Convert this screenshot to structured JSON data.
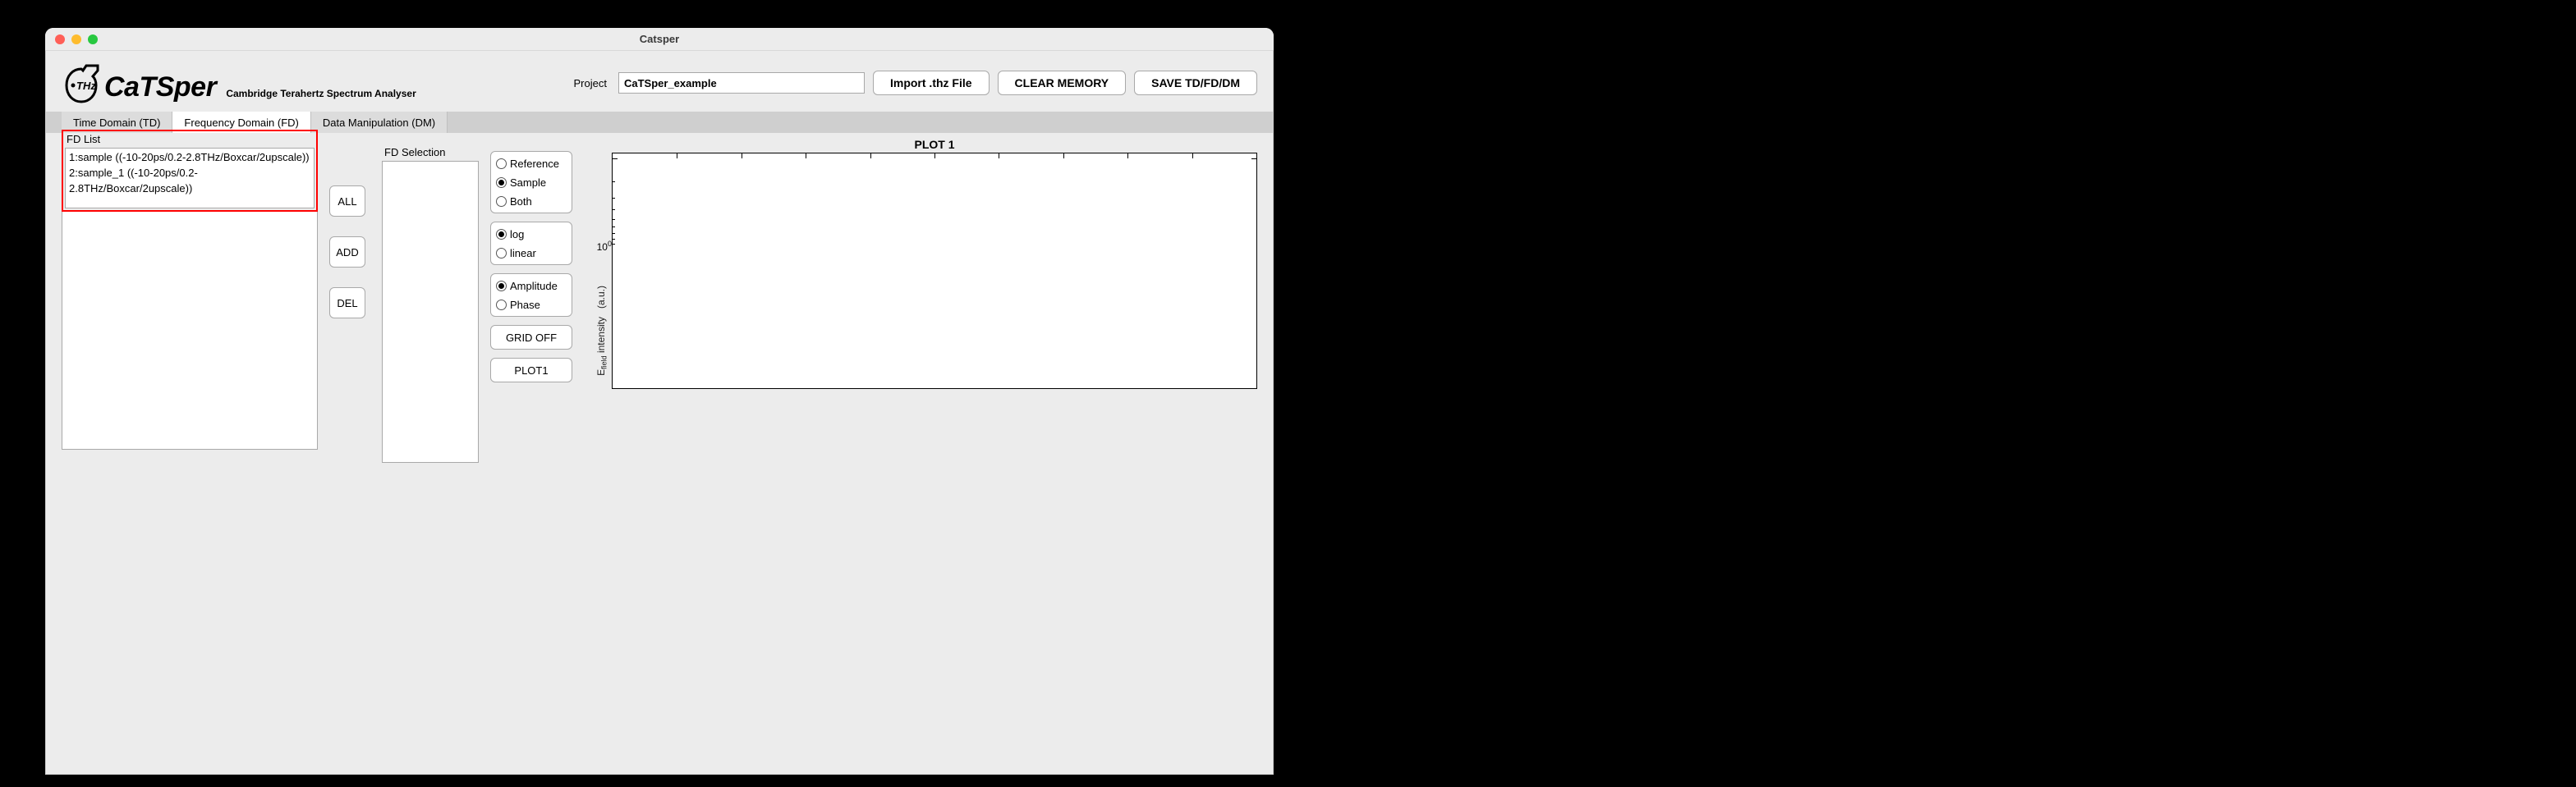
{
  "window_title": "Catsper",
  "app_name": "CaTSper",
  "app_subtitle": "Cambridge Terahertz Spectrum Analyser",
  "project_label": "Project",
  "project_value": "CaTSper_example",
  "header_buttons": {
    "import": "Import .thz File",
    "clear": "CLEAR MEMORY",
    "save": "SAVE TD/FD/DM"
  },
  "tabs": {
    "td": "Time Domain (TD)",
    "fd": "Frequency Domain (FD)",
    "dm": "Data Manipulation (DM)"
  },
  "fd_list_label": "FD List",
  "fd_list_items": [
    "1:sample ((-10-20ps/0.2-2.8THz/Boxcar/2upscale))",
    "2:sample_1 ((-10-20ps/0.2-2.8THz/Boxcar/2upscale))"
  ],
  "btns": {
    "all": "ALL",
    "add": "ADD",
    "del": "DEL"
  },
  "fd_sel_label": "FD Selection",
  "radios": {
    "reference": "Reference",
    "sample": "Sample",
    "both": "Both",
    "log": "log",
    "linear": "linear",
    "amplitude": "Amplitude",
    "phase": "Phase"
  },
  "grid_btn": "GRID OFF",
  "plot1_btn": "PLOT1",
  "plot_title": "PLOT 1",
  "ylabel_html": "E<sub>field</sub> intensity   (a.u.)",
  "ytick_html": "10<sup>0</sup>",
  "chart_data": {
    "type": "line",
    "title": "PLOT 1",
    "xlabel": "",
    "ylabel": "E_field intensity (a.u.)",
    "yscale": "log",
    "yticks_shown": [
      1
    ],
    "series": []
  }
}
